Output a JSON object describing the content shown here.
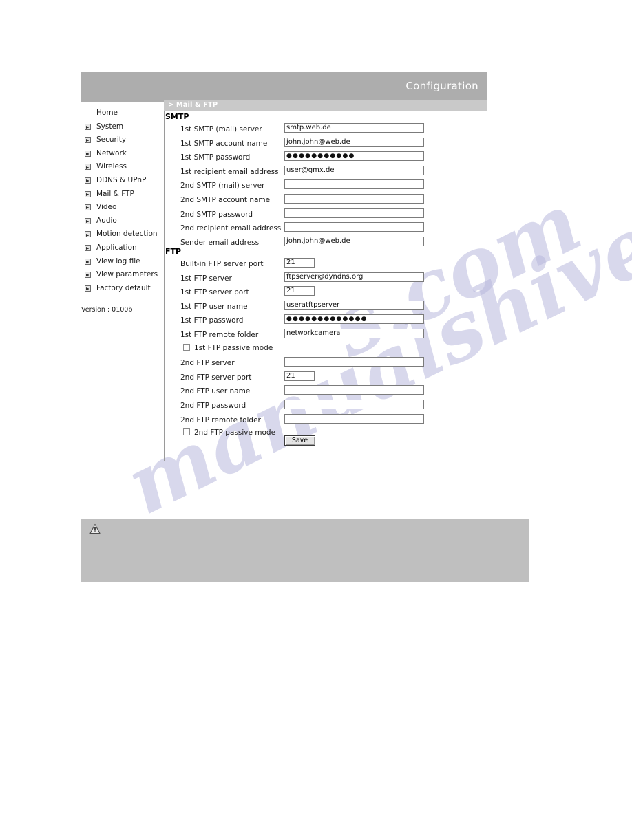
{
  "header": {
    "title": "Configuration"
  },
  "breadcrumb": {
    "text": "> Mail & FTP"
  },
  "sidebar": {
    "items": [
      {
        "label": "Home",
        "has_arrow": false
      },
      {
        "label": "System",
        "has_arrow": true
      },
      {
        "label": "Security",
        "has_arrow": true
      },
      {
        "label": "Network",
        "has_arrow": true
      },
      {
        "label": "Wireless",
        "has_arrow": true
      },
      {
        "label": "DDNS & UPnP",
        "has_arrow": true
      },
      {
        "label": "Mail & FTP",
        "has_arrow": true
      },
      {
        "label": "Video",
        "has_arrow": true
      },
      {
        "label": "Audio",
        "has_arrow": true
      },
      {
        "label": "Motion detection",
        "has_arrow": true
      },
      {
        "label": "Application",
        "has_arrow": true
      },
      {
        "label": "View log file",
        "has_arrow": true
      },
      {
        "label": "View parameters",
        "has_arrow": true
      },
      {
        "label": "Factory default",
        "has_arrow": true
      }
    ],
    "version": "Version : 0100b"
  },
  "smtp": {
    "title": "SMTP",
    "fields": [
      {
        "label": "1st SMTP (mail) server",
        "value": "smtp.web.de",
        "type": "text",
        "width": "wide"
      },
      {
        "label": "1st SMTP account name",
        "value": "john.john@web.de",
        "type": "text",
        "width": "wide"
      },
      {
        "label": "1st SMTP password",
        "value": "●●●●●●●●●●●",
        "type": "password",
        "width": "wide"
      },
      {
        "label": "1st recipient email address",
        "value": "user@gmx.de",
        "type": "text",
        "width": "wide"
      },
      {
        "label": "2nd SMTP (mail) server",
        "value": "",
        "type": "text",
        "width": "wide"
      },
      {
        "label": "2nd SMTP account name",
        "value": "",
        "type": "text",
        "width": "wide"
      },
      {
        "label": "2nd SMTP password",
        "value": "",
        "type": "password",
        "width": "wide"
      },
      {
        "label": "2nd recipient email address",
        "value": "",
        "type": "text",
        "width": "wide"
      },
      {
        "label": "Sender email address",
        "value": "john.john@web.de",
        "type": "text",
        "width": "wide"
      }
    ]
  },
  "ftp": {
    "title": "FTP",
    "fields": [
      {
        "label": "Built-in FTP server port",
        "value": "21",
        "type": "text",
        "width": "narrow"
      },
      {
        "label": "1st FTP server",
        "value": "ftpserver@dyndns.org",
        "type": "text",
        "width": "wide"
      },
      {
        "label": "1st FTP server port",
        "value": "21",
        "type": "text",
        "width": "narrow"
      },
      {
        "label": "1st FTP user name",
        "value": "useratftpserver",
        "type": "text",
        "width": "wide"
      },
      {
        "label": "1st FTP password",
        "value": "●●●●●●●●●●●●●",
        "type": "password",
        "width": "wide"
      },
      {
        "label": "1st FTP remote folder",
        "value": "networkcamera",
        "type": "text",
        "width": "wide",
        "focused": true
      }
    ],
    "checkbox_1st": {
      "label": "1st FTP passive mode",
      "checked": false
    },
    "fields2": [
      {
        "label": "2nd FTP server",
        "value": "",
        "type": "text",
        "width": "wide"
      },
      {
        "label": "2nd FTP server port",
        "value": "21",
        "type": "text",
        "width": "narrow"
      },
      {
        "label": "2nd FTP user name",
        "value": "",
        "type": "text",
        "width": "wide"
      },
      {
        "label": "2nd FTP password",
        "value": "",
        "type": "password",
        "width": "wide"
      },
      {
        "label": "2nd FTP remote folder",
        "value": "",
        "type": "text",
        "width": "wide"
      }
    ],
    "checkbox_2nd": {
      "label": "2nd FTP passive mode",
      "checked": false
    }
  },
  "actions": {
    "save_label": "Save"
  },
  "note_panel": {
    "icon": "warning-triangle-icon",
    "text": ""
  },
  "watermark": {
    "line1": "manualshive",
    "line2": "s.com"
  },
  "colors": {
    "header_bar": "#adadad",
    "breadcrumb_bar": "#c9c9c9",
    "note_panel": "#bfbfbf",
    "text": "#1a1a1a",
    "header_text": "#ffffff"
  }
}
